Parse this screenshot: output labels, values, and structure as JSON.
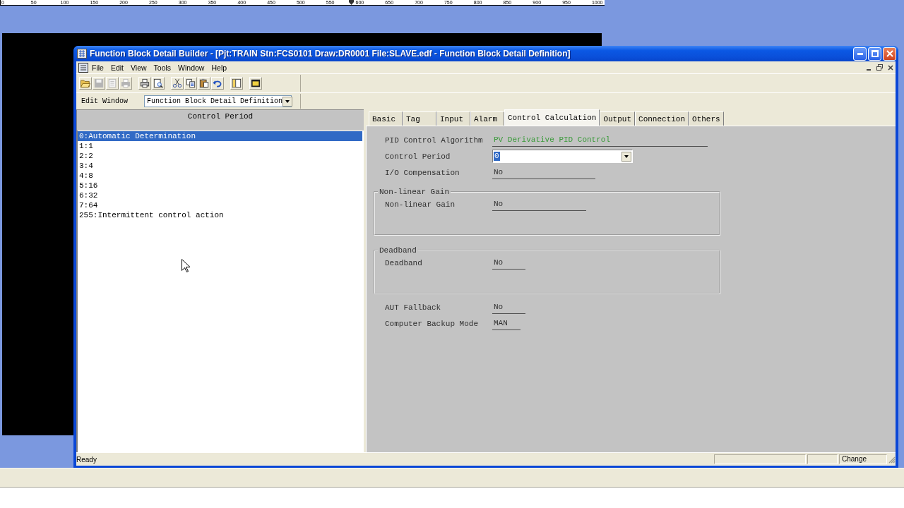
{
  "ruler": {
    "labels": [
      "0",
      "50",
      "100",
      "150",
      "200",
      "250",
      "300",
      "350",
      "400",
      "450",
      "500",
      "550",
      "600",
      "650",
      "700",
      "750",
      "800",
      "850",
      "900",
      "950",
      "1000"
    ]
  },
  "window": {
    "title": "Function Block Detail Builder - [Pjt:TRAIN Stn:FCS0101 Draw:DR0001 File:SLAVE.edf - Function Block Detail Definition]"
  },
  "menu": [
    "File",
    "Edit",
    "View",
    "Tools",
    "Window",
    "Help"
  ],
  "toolbar": [
    [
      {
        "kind": "open",
        "disabled": false
      },
      {
        "kind": "save",
        "disabled": true
      },
      {
        "kind": "tree",
        "disabled": true
      },
      {
        "kind": "print",
        "disabled": true
      }
    ],
    [
      {
        "kind": "print",
        "disabled": false
      },
      {
        "kind": "preview",
        "disabled": false
      }
    ],
    [
      {
        "kind": "cut",
        "disabled": false
      },
      {
        "kind": "copy",
        "disabled": false
      },
      {
        "kind": "paste",
        "disabled": false
      },
      {
        "kind": "undo",
        "disabled": false
      }
    ],
    [
      {
        "kind": "panel",
        "disabled": false
      }
    ],
    [
      {
        "kind": "window",
        "disabled": false
      }
    ]
  ],
  "edit_window": {
    "label": "Edit Window",
    "value": "Function Block Detail Definition"
  },
  "list_panel": {
    "title": "Control Period",
    "items": [
      {
        "label": "0:Automatic Determination",
        "selected": true
      },
      {
        "label": "1:1",
        "selected": false
      },
      {
        "label": "2:2",
        "selected": false
      },
      {
        "label": "3:4",
        "selected": false
      },
      {
        "label": "4:8",
        "selected": false
      },
      {
        "label": "5:16",
        "selected": false
      },
      {
        "label": "6:32",
        "selected": false
      },
      {
        "label": "7:64",
        "selected": false
      },
      {
        "label": "255:Intermittent control action",
        "selected": false
      }
    ]
  },
  "tabs": [
    {
      "label": "Basic",
      "selected": false
    },
    {
      "label": "Tag",
      "selected": false
    },
    {
      "label": "Input",
      "selected": false
    },
    {
      "label": "Alarm",
      "selected": false
    },
    {
      "label": "Control Calculation",
      "selected": true
    },
    {
      "label": "Output",
      "selected": false
    },
    {
      "label": "Connection",
      "selected": false
    },
    {
      "label": "Others",
      "selected": false
    }
  ],
  "form": [
    {
      "kind": "fixed",
      "label": "PID Control Algorithm",
      "value": "PV Derivative PID Control"
    },
    {
      "kind": "dropdown",
      "label": "Control Period",
      "value": "0",
      "focused": true
    },
    {
      "kind": "value",
      "label": "I/O Compensation",
      "value": "No"
    },
    {
      "kind": "group",
      "title": "Non-linear Gain",
      "fields": [
        {
          "kind": "value",
          "label": "Non-linear Gain",
          "value": "No"
        }
      ]
    },
    {
      "kind": "group",
      "title": "Deadband",
      "fields": [
        {
          "kind": "value",
          "label": "Deadband",
          "value": "No"
        }
      ]
    },
    {
      "kind": "value",
      "label": "AUT Fallback",
      "value": "No"
    },
    {
      "kind": "value",
      "label": "Computer Backup Mode",
      "value": "MAN"
    }
  ],
  "status_bar": {
    "message": "Ready",
    "indicator": "Change"
  }
}
